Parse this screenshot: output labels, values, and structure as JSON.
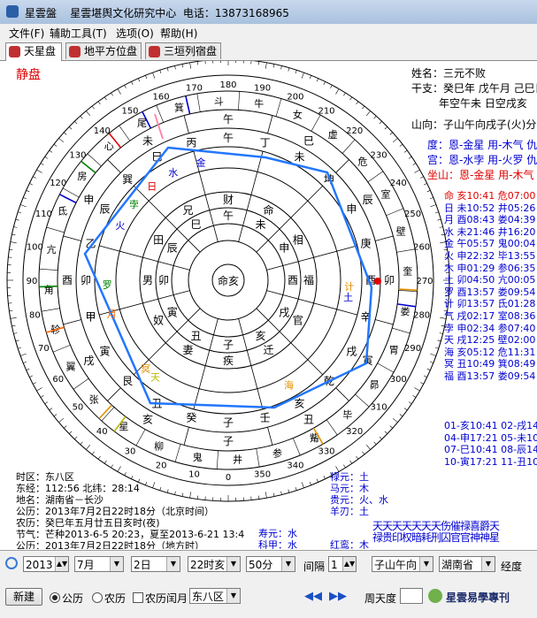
{
  "window": {
    "title": "星雲盤    星雲堪舆文化研究中心  电话：13873168965"
  },
  "menu": [
    "文件(F)",
    "辅助工具(T)",
    "选项(O)",
    "帮助(H)"
  ],
  "tabs": [
    {
      "label": "天星盘",
      "active": true
    },
    {
      "label": "地平方位盘",
      "active": false
    },
    {
      "label": "三垣列宿盘",
      "active": false
    }
  ],
  "chart": {
    "corner_label": "静盘",
    "info": {
      "name": "姓名：三元不败",
      "ganzhi1": "干支：癸巳年 戊午月 己巳日",
      "ganzhi2": "年空午未  日空戌亥",
      "shanxiang": "山向：子山午向戌子(火)分金",
      "du": "度：恩-金星 用-木气 仇-",
      "gong": "宫：恩-水孛 用-火罗 仇-",
      "zuoshan": "坐山：恩-金星 用-木气 仇"
    },
    "stars": [
      {
        "text": "命 亥10:41 危07:00",
        "color": "#e00000"
      },
      {
        "text": "日 未10:52 井05:26",
        "color": "#0000d0"
      },
      {
        "text": "月 酉08:43 娄04:39",
        "color": "#0000d0"
      },
      {
        "text": "水 未21:46 井16:20",
        "color": "#0000d0"
      },
      {
        "text": "金 午05:57 鬼00:04",
        "color": "#0000d0"
      },
      {
        "text": "火 申22:32 毕13:55",
        "color": "#0000d0"
      },
      {
        "text": "木 申01:29 参06:35",
        "color": "#0000d0"
      },
      {
        "text": "土 卯04:50 亢00:05",
        "color": "#0000d0"
      },
      {
        "text": "罗 酉13:57 娄09:54",
        "color": "#0000d0"
      },
      {
        "text": "计 卯13:57 氐01:28",
        "color": "#0000d0"
      },
      {
        "text": "气 戌02:17 室08:36",
        "color": "#0000d0"
      },
      {
        "text": "孛 申02:34 参07:40",
        "color": "#0000d0"
      },
      {
        "text": "天 戌12:25 壁02:00",
        "color": "#0000d0"
      },
      {
        "text": "海 亥05:12 危11:31",
        "color": "#0000d0"
      },
      {
        "text": "冥 丑10:49 箕08:49",
        "color": "#0000d0"
      },
      {
        "text": "福 酉13:57 娄09:54",
        "color": "#0000d0"
      }
    ],
    "houses": [
      {
        "text": "01-亥10:41   02-戌14",
        "color": "#0000d0"
      },
      {
        "text": "04-申17:21   05-未10",
        "color": "#0000d0"
      },
      {
        "text": "07-巳10:41   08-辰14",
        "color": "#0000d0"
      },
      {
        "text": "10-寅17:21   11-丑10",
        "color": "#0000d0"
      }
    ],
    "location": {
      "zone": "时区：东八区",
      "coords": "东经：112:56  北纬：28:14",
      "place": "地名：湖南省－长沙",
      "solar": "公历：2013年7月2日22时18分（北京时间）",
      "lunar": "农历：癸巳年五月廿五日亥时(夜)",
      "jieqi": "节气：芒种2013-6-5 20:23，夏至2013-6-21 13:4",
      "solar2": "公历：2013年7月2日22时18分（地方时）"
    },
    "bottom_stars": {
      "lu": "禄元：土",
      "ma": "马元：木",
      "gui": "贵元：火、水",
      "ren": "羊刃：土",
      "shou": "寿元：水",
      "ke": "科甲：水",
      "hong": "红鸾：木"
    },
    "shensha": {
      "row1": "天天天天天天天伤催禄喜爵天",
      "row2": "禄贵印权暗耗刑囚官官神神星"
    },
    "ring_degree_labels": [
      "0",
      "10",
      "20",
      "30",
      "40",
      "50",
      "60",
      "70",
      "80",
      "90",
      "100",
      "110",
      "120",
      "130",
      "140",
      "150",
      "160",
      "170",
      "180",
      "190",
      "200",
      "210",
      "220",
      "230",
      "240",
      "250",
      "260",
      "270",
      "280",
      "290",
      "300",
      "310",
      "320",
      "330",
      "340",
      "350"
    ],
    "ring_xiu": [
      "角",
      "亢",
      "氐",
      "房",
      "心",
      "尾",
      "箕",
      "斗",
      "牛",
      "女",
      "虚",
      "危",
      "室",
      "壁",
      "奎",
      "娄",
      "胃",
      "昴",
      "毕",
      "觜",
      "参",
      "井",
      "鬼",
      "柳",
      "星",
      "张",
      "翼",
      "轸"
    ],
    "ring_branch": [
      "子",
      "丑",
      "寅",
      "卯",
      "辰",
      "巳",
      "午",
      "未",
      "申",
      "酉",
      "戌",
      "亥"
    ],
    "ring_24": [
      "子",
      "癸",
      "丑",
      "艮",
      "寅",
      "甲",
      "卯",
      "乙",
      "辰",
      "巽",
      "巳",
      "丙",
      "午",
      "丁",
      "未",
      "坤",
      "申",
      "庚",
      "酉",
      "辛",
      "戌",
      "乾",
      "亥",
      "壬"
    ],
    "ring_palaces": [
      "命",
      "财",
      "兄",
      "田",
      "男",
      "奴",
      "妻",
      "疾",
      "迁",
      "官",
      "福",
      "相"
    ],
    "inner_branch": [
      "子",
      "丑",
      "寅",
      "卯",
      "辰",
      "巳",
      "午",
      "未",
      "申",
      "酉",
      "戌",
      "亥"
    ],
    "center": "命亥",
    "planet_marks": [
      {
        "label": "金",
        "angle": 103,
        "color": "#0000d0"
      },
      {
        "label": "水",
        "angle": 117,
        "color": "#0000d0"
      },
      {
        "label": "日",
        "angle": 129,
        "color": "#e00000"
      },
      {
        "label": "孛",
        "angle": 141,
        "color": "#008000"
      },
      {
        "label": "火",
        "angle": 153,
        "color": "#0000d0"
      },
      {
        "label": "罗",
        "angle": 182,
        "color": "#008000"
      },
      {
        "label": "月",
        "angle": 196,
        "color": "#ff6600"
      },
      {
        "label": "天",
        "angle": 233,
        "color": "#b8b800"
      },
      {
        "label": "海",
        "angle": 300,
        "color": "#e09000"
      },
      {
        "label": "冥",
        "angle": 227,
        "color": "#e09000"
      },
      {
        "label": "土",
        "angle": 352,
        "color": "#0000d0"
      },
      {
        "label": "计",
        "angle": 357,
        "color": "#e09000"
      }
    ]
  },
  "controls": {
    "year": "2013",
    "month": "7月",
    "day": "2日",
    "hour": "22时亥",
    "minute": "50分",
    "interval_label": "间隔",
    "interval": "1",
    "direction": "子山午向",
    "province": "湖南省",
    "longitude_label": "经度",
    "new_button": "新建",
    "solar_radio": "公历",
    "lunar_radio": "农历",
    "leap_label": "农历闰月",
    "zone_select": "东八区",
    "zhoutian_label": "周天度",
    "watermark": "星雲易學專刊"
  }
}
